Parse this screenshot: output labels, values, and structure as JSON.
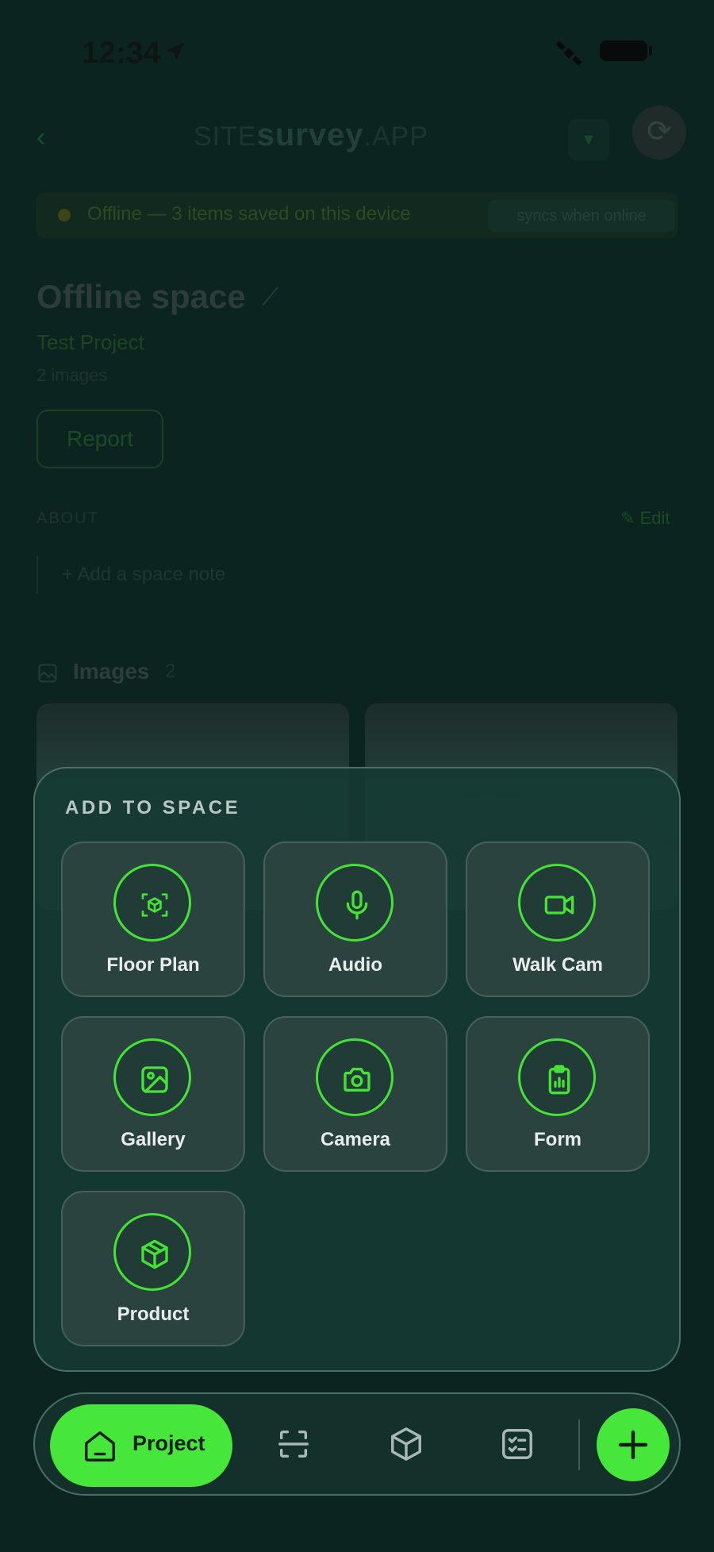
{
  "status_bar": {
    "time": "12:34"
  },
  "header": {
    "brand_prefix": "SITE",
    "brand_main": "survey",
    "brand_suffix": ".APP"
  },
  "offline_banner": {
    "text": "Offline — 3 items saved on this device",
    "action": "syncs when online"
  },
  "space": {
    "title": "Offline space",
    "project": "Test Project",
    "images_count": "2 images",
    "report_label": "Report"
  },
  "about": {
    "label": "ABOUT",
    "edit_label": "Edit",
    "add_note": "Add a space note"
  },
  "images_section": {
    "title": "Images",
    "count": "2"
  },
  "sheet": {
    "title": "ADD TO SPACE",
    "tiles": [
      {
        "label": "Floor Plan",
        "icon": "floor-plan-icon"
      },
      {
        "label": "Audio",
        "icon": "microphone-icon"
      },
      {
        "label": "Walk Cam",
        "icon": "video-camera-icon"
      },
      {
        "label": "Gallery",
        "icon": "image-icon"
      },
      {
        "label": "Camera",
        "icon": "camera-icon"
      },
      {
        "label": "Form",
        "icon": "clipboard-icon"
      },
      {
        "label": "Product",
        "icon": "box-icon"
      }
    ]
  },
  "bottom_nav": {
    "project_label": "Project"
  },
  "colors": {
    "accent": "#46e73a",
    "sheet_bg": "#163a34",
    "tile_bg": "#2b433f"
  }
}
